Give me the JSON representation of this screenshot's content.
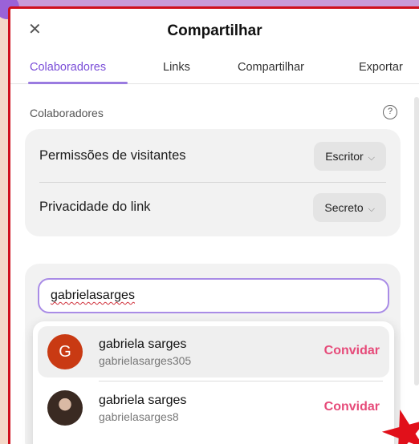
{
  "dialog": {
    "title": "Compartilhar",
    "close_icon": "close-icon"
  },
  "tabs": [
    {
      "label": "Colaboradores",
      "active": true
    },
    {
      "label": "Links",
      "active": false
    },
    {
      "label": "Compartilhar",
      "active": false
    },
    {
      "label": "Exportar",
      "active": false
    }
  ],
  "collaborators": {
    "section_label": "Colaboradores",
    "help_icon": "help-circle-icon",
    "permissions": {
      "label": "Permissões de visitantes",
      "value": "Escritor"
    },
    "privacy": {
      "label": "Privacidade do link",
      "value": "Secreto"
    }
  },
  "search": {
    "value": "gabrielasarges"
  },
  "results": [
    {
      "name": "gabriela sarges",
      "username": "gabrielasarges305",
      "avatar_letter": "G",
      "action": "Convidar",
      "highlighted": true
    },
    {
      "name": "gabriela sarges",
      "username": "gabrielasarges8",
      "avatar_letter": "",
      "action": "Convidar",
      "highlighted": false
    }
  ],
  "colors": {
    "accent": "#7a4dd8",
    "invite": "#e64a79",
    "frame_border": "#cf0f1c",
    "avatar_bg": "#c93a13"
  }
}
